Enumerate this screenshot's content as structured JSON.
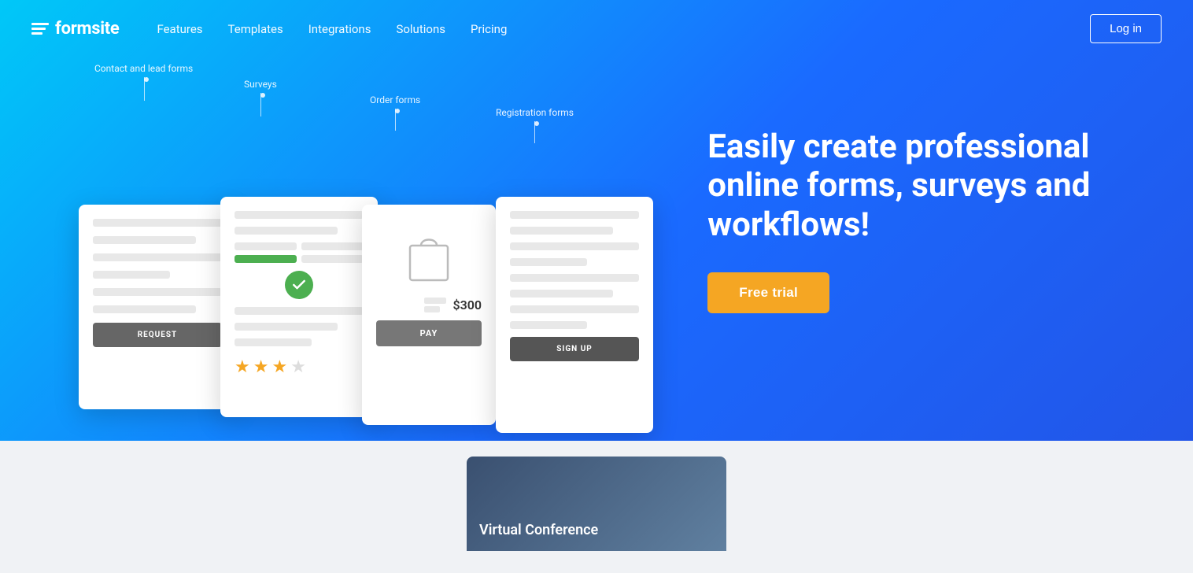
{
  "header": {
    "logo_text": "formsite",
    "nav_items": [
      "Features",
      "Templates",
      "Integrations",
      "Solutions",
      "Pricing"
    ],
    "login_label": "Log in"
  },
  "hero": {
    "headline": "Easily create professional online forms, surveys and workflows!",
    "cta_label": "Free trial",
    "form_labels": {
      "contact": "Contact and lead forms",
      "surveys": "Surveys",
      "order": "Order forms",
      "registration": "Registration forms"
    },
    "order_price": "$300",
    "request_btn": "REQUEST",
    "pay_btn": "PAY",
    "signup_btn": "SIGN UP"
  },
  "below": {
    "conference_title": "Virtual Conference"
  },
  "colors": {
    "hero_gradient_start": "#00c8f8",
    "hero_gradient_end": "#2255e8",
    "cta_bg": "#f5a623",
    "check_green": "#4caf50"
  }
}
